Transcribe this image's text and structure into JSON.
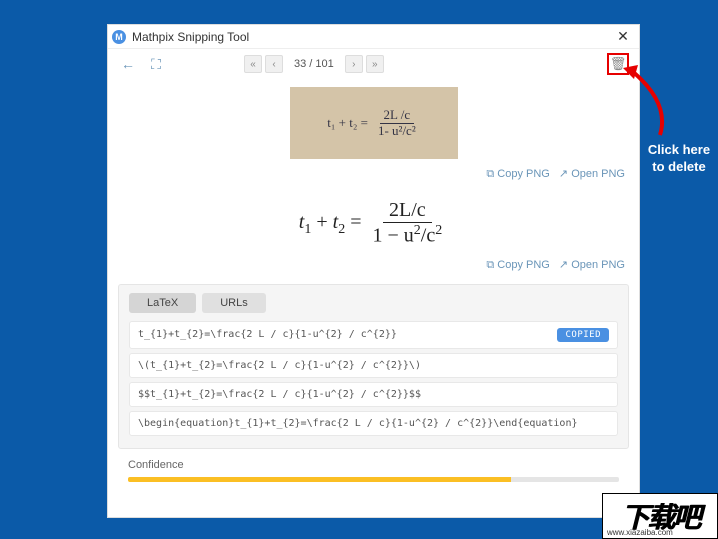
{
  "titlebar": {
    "logo_letter": "M",
    "title": "Mathpix Snipping Tool",
    "close": "✕"
  },
  "toolbar": {
    "back_icon": "←",
    "screen_icon": "⛶",
    "first": "«",
    "prev": "‹",
    "counter": "33 / 101",
    "next": "›",
    "last": "»",
    "trash": "🗑"
  },
  "snip": {
    "left": "t₁ + t₂ =",
    "num": "2L /c",
    "den": "1- u²/c²"
  },
  "actions": {
    "copy_icon": "⧉",
    "copy": "Copy PNG",
    "open_icon": "↗",
    "open": "Open PNG"
  },
  "rendered": {
    "left_a": "t",
    "left_s1": "1",
    "left_p": " + ",
    "left_b": "t",
    "left_s2": "2",
    "left_eq": " = ",
    "num": "2L/c",
    "den_a": "1 − u",
    "den_s1": "2",
    "den_b": "/c",
    "den_s2": "2"
  },
  "panel": {
    "tabs": {
      "latex": "LaTeX",
      "urls": "URLs"
    },
    "rows": [
      "t_{1}+t_{2}=\\frac{2 L / c}{1-u^{2} / c^{2}}",
      "\\(t_{1}+t_{2}=\\frac{2 L / c}{1-u^{2} / c^{2}}\\)",
      "$$t_{1}+t_{2}=\\frac{2 L / c}{1-u^{2} / c^{2}}$$",
      "\\begin{equation}t_{1}+t_{2}=\\frac{2 L / c}{1-u^{2} / c^{2}}\\end{equation}"
    ],
    "copied": "COPIED"
  },
  "confidence": {
    "label": "Confidence"
  },
  "callout": {
    "line1": "Click here",
    "line2": "to delete"
  },
  "watermark": {
    "text": "下载吧",
    "url": "www.xiazaiba.com"
  }
}
